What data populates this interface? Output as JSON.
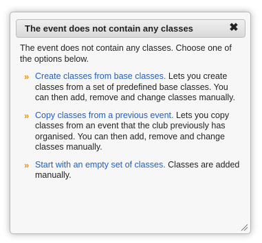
{
  "dialog": {
    "title": "The event does not contain any classes",
    "close_glyph": "✖",
    "intro": "The event does not contain any classes. Choose one of the options below.",
    "bullet_glyph": "»",
    "options": [
      {
        "link": "Create classes from base classes.",
        "text": " Lets you create classes from a set of predefined base classes. You can then add, remove and change classes manually."
      },
      {
        "link": "Copy classes from a previous event.",
        "text": " Lets you copy classes from an event that the club previously has organised. You can then add, remove and change classes manually."
      },
      {
        "link": "Start with an empty set of classes.",
        "text": " Classes are added manually."
      }
    ]
  },
  "colors": {
    "link": "#1f5fbf",
    "bullet": "#f39200"
  },
  "icons": {
    "close": "close-icon",
    "bullet": "double-chevron-icon",
    "resize": "resize-grip-icon"
  }
}
